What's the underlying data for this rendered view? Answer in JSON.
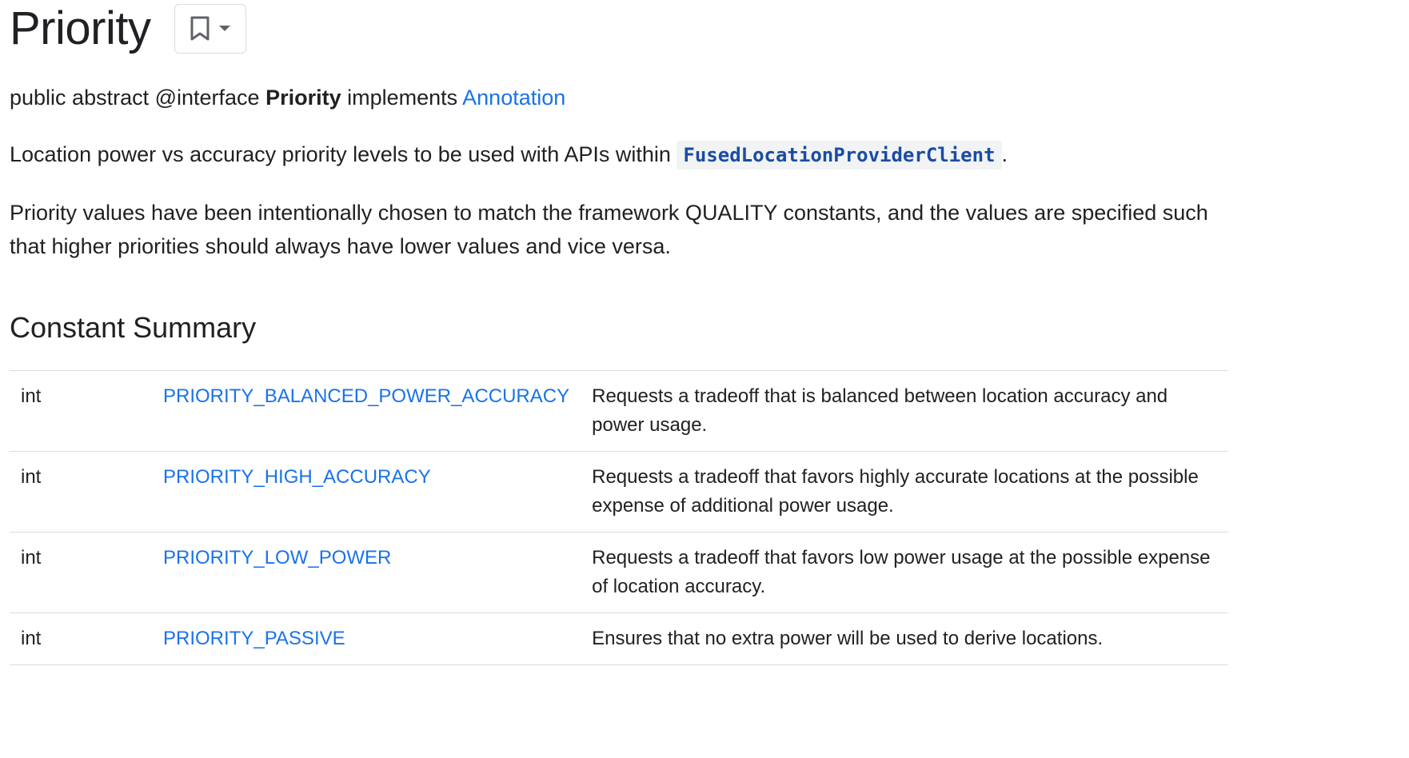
{
  "header": {
    "title": "Priority",
    "bookmark_icon": "bookmark-icon",
    "dropdown_icon": "arrow-drop-down-icon"
  },
  "signature": {
    "prefix": "public abstract @interface ",
    "name": "Priority",
    "implements_text": " implements ",
    "interface_link": "Annotation"
  },
  "description": {
    "para1_text": "Location power vs accuracy priority levels to be used with APIs within ",
    "para1_code": "FusedLocationProviderClient",
    "para1_suffix": ".",
    "para2": "Priority values have been intentionally chosen to match the framework QUALITY constants, and the values are specified such that higher priorities should always have lower values and vice versa."
  },
  "constant_summary": {
    "title": "Constant Summary",
    "rows": [
      {
        "type": "int",
        "name": "PRIORITY_BALANCED_POWER_ACCURACY",
        "description": "Requests a tradeoff that is balanced between location accuracy and power usage."
      },
      {
        "type": "int",
        "name": "PRIORITY_HIGH_ACCURACY",
        "description": "Requests a tradeoff that favors highly accurate locations at the possible expense of additional power usage."
      },
      {
        "type": "int",
        "name": "PRIORITY_LOW_POWER",
        "description": "Requests a tradeoff that favors low power usage at the possible expense of location accuracy."
      },
      {
        "type": "int",
        "name": "PRIORITY_PASSIVE",
        "description": "Ensures that no extra power will be used to derive locations."
      }
    ]
  },
  "colors": {
    "link": "#1a73e8",
    "text": "#202124",
    "code_text": "#1a4ca3",
    "code_bg": "#f1f3f4",
    "divider": "#dadce0"
  }
}
